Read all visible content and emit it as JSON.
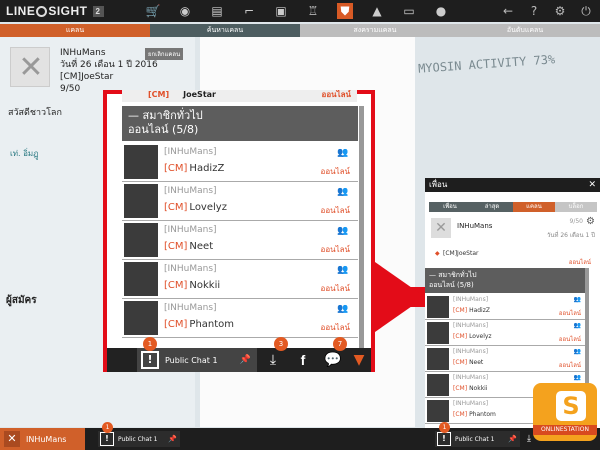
{
  "app": {
    "logo_left": "LINE",
    "logo_right": "SIGHT",
    "level": "2"
  },
  "top_icons": [
    {
      "name": "shop-cart-icon",
      "glyph": "🛒"
    },
    {
      "name": "mask-icon",
      "glyph": "◉"
    },
    {
      "name": "package-icon",
      "glyph": "▤"
    },
    {
      "name": "gun-icon",
      "glyph": "⌐"
    },
    {
      "name": "save-icon",
      "glyph": "▣"
    },
    {
      "name": "trophy-icon",
      "glyph": "♖"
    },
    {
      "name": "shield-icon",
      "glyph": "⛊"
    },
    {
      "name": "tent-icon",
      "glyph": "▲"
    },
    {
      "name": "monitor-icon",
      "glyph": "▭"
    },
    {
      "name": "bulb-icon",
      "glyph": "●"
    }
  ],
  "top_right": [
    {
      "name": "back-icon",
      "glyph": "←"
    },
    {
      "name": "help-icon",
      "glyph": "?"
    },
    {
      "name": "settings-icon",
      "glyph": "⚙"
    },
    {
      "name": "power-icon",
      "glyph": "⏻"
    }
  ],
  "tabs": [
    "แคลน",
    "ค้นหาแคลน",
    "สงครามแคลน",
    "อันดับแคลน"
  ],
  "clan": {
    "name": "INHuMans",
    "founded": "วันที่ 26 เดือน 1 ปี 2016",
    "leader": "[CM]JoeStar",
    "count": "9/50",
    "badge": "ยกเลิกแคลน",
    "motto": "สวัสดีชาวโลก",
    "more": "เท่. อิ่มฏู"
  },
  "members_header": "ผู้สมัคร",
  "watermark_text": "MYOSIN ACTIVITY 73%",
  "zoom": {
    "header_clan": "[CM]",
    "header_name": "JoeStar",
    "header_status": "ออนไลน์",
    "group_title": "สมาชิกทั่วไป",
    "group_sub": "ออนไลน์ (5/8)",
    "members": [
      {
        "clan": "[INHuMans]",
        "tag": "[CM]",
        "name": "HadizZ",
        "status": "ออนไลน์"
      },
      {
        "clan": "[INHuMans]",
        "tag": "[CM]",
        "name": "Lovelyz",
        "status": "ออนไลน์"
      },
      {
        "clan": "[INHuMans]",
        "tag": "[CM]",
        "name": "Neet",
        "status": "ออนไลน์"
      },
      {
        "clan": "[INHuMans]",
        "tag": "[CM]",
        "name": "Nokkii",
        "status": "ออนไลน์"
      },
      {
        "clan": "[INHuMans]",
        "tag": "[CM]",
        "name": "Phantom",
        "status": "ออนไลน์"
      }
    ],
    "chat_label": "Public Chat 1",
    "badges": [
      "1",
      "3",
      "7"
    ]
  },
  "friends_panel": {
    "title": "เพื่อน",
    "close": "✕",
    "tabs": [
      "เพื่อน",
      "ล่าสุด",
      "แคลน",
      "บล็อก"
    ],
    "clan_name": "INHuMans",
    "count": "9/50",
    "date": "วันที่ 26 เดือน 1 ปี",
    "leader": "[CM]JoeStar",
    "leader_status": "ออนไลน์",
    "group_title": "สมาชิกทั่วไป",
    "group_sub": "ออนไลน์ (5/8)",
    "members": [
      {
        "clan": "[INHuMans]",
        "tag": "[CM]",
        "name": "HadizZ",
        "status": "ออนไลน์"
      },
      {
        "clan": "[INHuMans]",
        "tag": "[CM]",
        "name": "Lovelyz",
        "status": "ออนไลน์"
      },
      {
        "clan": "[INHuMans]",
        "tag": "[CM]",
        "name": "Neet",
        "status": "ออนไลน์"
      },
      {
        "clan": "[INHuMans]",
        "tag": "[CM]",
        "name": "Nokkii",
        "status": "ออนไลน์"
      },
      {
        "clan": "[INHuMans]",
        "tag": "[CM]",
        "name": "Phantom",
        "status": "ออนไลน์"
      }
    ]
  },
  "bottom": {
    "clan": "INHuMans",
    "chat": "Public Chat 1",
    "badge": "1",
    "right_chat": "Public Chat 1",
    "right_badge": "1"
  },
  "site_watermark": {
    "letter": "S",
    "text": "ONLINESTATION"
  }
}
